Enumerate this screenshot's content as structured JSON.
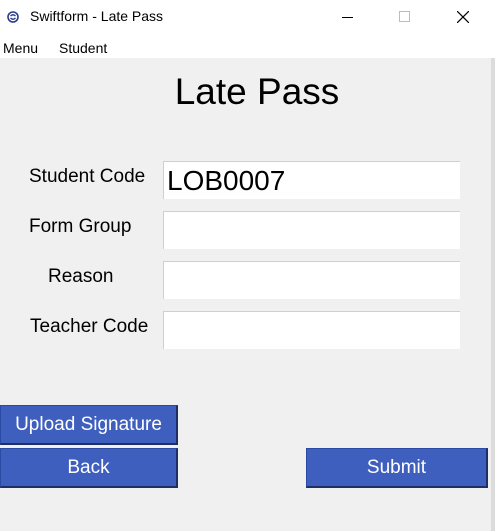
{
  "window": {
    "title": "Swiftform - Late Pass",
    "app_icon": "swiftform-logo-icon",
    "controls": [
      "minimize-icon",
      "maximize-icon",
      "close-icon"
    ]
  },
  "menubar": {
    "items": [
      {
        "label": "Menu"
      },
      {
        "label": "Student"
      }
    ]
  },
  "page": {
    "title": "Late Pass"
  },
  "form": {
    "fields": [
      {
        "label": "Student Code",
        "value": "LOB0007"
      },
      {
        "label": "Form Group",
        "value": ""
      },
      {
        "label": "Reason",
        "value": ""
      },
      {
        "label": "Teacher Code",
        "value": ""
      }
    ]
  },
  "buttons": {
    "upload_signature": "Upload Signature",
    "back": "Back",
    "submit": "Submit"
  },
  "colors": {
    "button_bg": "#3f5fbf",
    "button_text": "#ffffff",
    "window_bg": "#f0f0f0"
  }
}
